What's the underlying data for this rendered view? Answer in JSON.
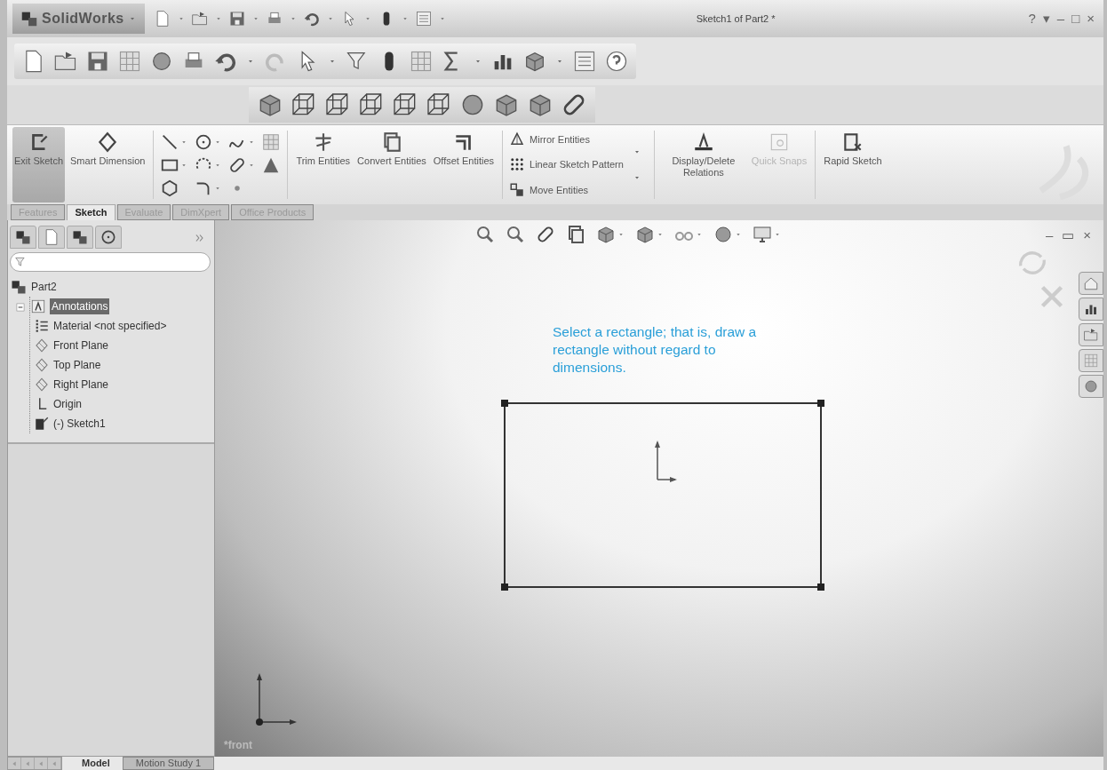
{
  "title_bar": {
    "logo": "SolidWorks",
    "title": "Sketch1 of Part2 *",
    "controls": [
      "?",
      "▾",
      "–",
      "□",
      "×"
    ]
  },
  "command_manager": [
    {
      "kind": "large",
      "label": "Exit Sketch",
      "selected": true,
      "disabled": false
    },
    {
      "kind": "large",
      "label": "Smart Dimension",
      "selected": false,
      "disabled": false
    },
    {
      "kind": "tools"
    },
    {
      "kind": "large",
      "label": "Trim Entities",
      "selected": false,
      "disabled": false
    },
    {
      "kind": "large",
      "label": "Convert Entities",
      "selected": false,
      "disabled": false
    },
    {
      "kind": "large",
      "label": "Offset Entities",
      "selected": false,
      "disabled": false
    },
    {
      "kind": "list",
      "items": [
        "Mirror Entities",
        "Linear Sketch Pattern",
        "Move Entities"
      ]
    },
    {
      "kind": "large",
      "label": "Display/Delete Relations",
      "selected": false,
      "disabled": false
    },
    {
      "kind": "large",
      "label": "Quick Snaps",
      "selected": false,
      "disabled": true
    },
    {
      "kind": "large",
      "label": "Rapid Sketch",
      "selected": false,
      "disabled": false
    }
  ],
  "tabs": [
    {
      "label": "Features",
      "selected": false
    },
    {
      "label": "Sketch",
      "selected": true
    },
    {
      "label": "Evaluate",
      "selected": false
    },
    {
      "label": "DimXpert",
      "selected": false
    },
    {
      "label": "Office Products",
      "selected": false
    }
  ],
  "tree": {
    "label": "Part2",
    "selected": false,
    "children": [
      {
        "kind": "annotations",
        "label": "Annotations",
        "selected": true
      },
      {
        "kind": "material",
        "label": "Material <not specified>",
        "selected": false
      },
      {
        "kind": "plane",
        "label": "Front Plane",
        "selected": false
      },
      {
        "kind": "plane",
        "label": "Top Plane",
        "selected": false
      },
      {
        "kind": "plane",
        "label": "Right Plane",
        "selected": false
      },
      {
        "kind": "origin",
        "label": "Origin",
        "selected": false
      },
      {
        "kind": "sketch",
        "label": "(-) Sketch1",
        "selected": false
      }
    ]
  },
  "graphics": {
    "note": "Select a rectangle; that is, draw a rectangle without regard to dimensions.",
    "view_label": "*front",
    "doc_controls": [
      "–",
      "▭",
      "×"
    ]
  },
  "bottom_tabs": [
    {
      "label": "Model",
      "selected": true
    },
    {
      "label": "Motion Study 1",
      "selected": false
    }
  ]
}
